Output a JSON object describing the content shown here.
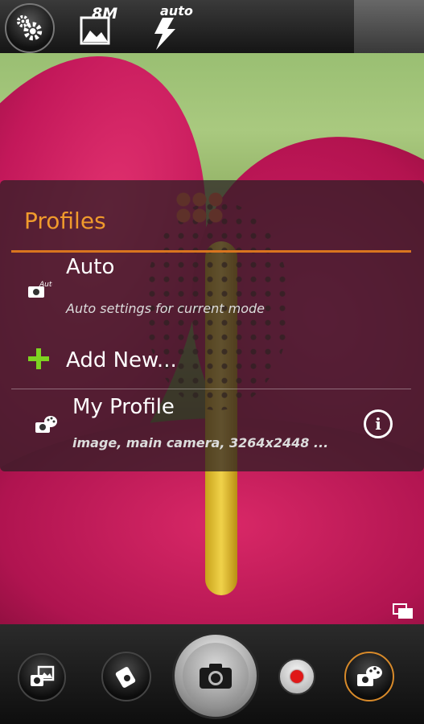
{
  "topbar": {
    "settings_icon": "gears-icon",
    "resolution_label": "8M",
    "flash_label": "auto"
  },
  "profiles": {
    "title": "Profiles",
    "items": [
      {
        "icon": "camera-auto-icon",
        "title": "Auto",
        "subtitle": "Auto settings for current mode"
      },
      {
        "icon": "plus-icon",
        "title": "Add New..."
      },
      {
        "icon": "camera-palette-icon",
        "title": "My Profile",
        "subtitle": "image, main camera, 3264x2448 ...",
        "action_icon": "info-icon"
      }
    ]
  },
  "bottombar": {
    "buttons": [
      "gallery-switch-icon",
      "switch-camera-icon",
      "shutter-camera-icon",
      "record-video-icon",
      "effects-palette-icon"
    ]
  },
  "colors": {
    "accent": "#f09a2c",
    "divider": "#d9751f",
    "record": "#e01818",
    "plus": "#7dd321"
  }
}
